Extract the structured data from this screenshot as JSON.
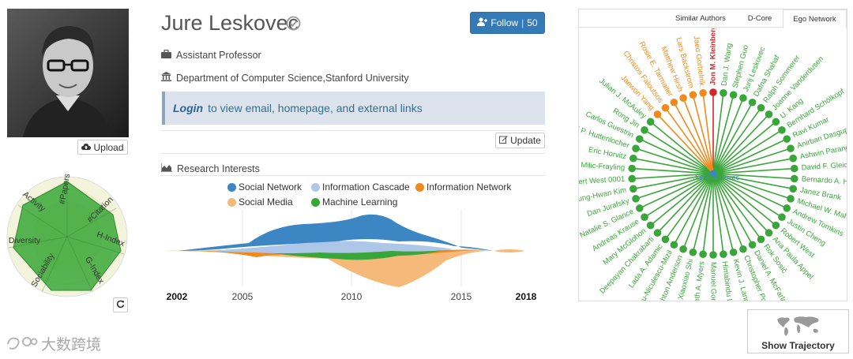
{
  "profile": {
    "name": "Jure Leskovec",
    "follow_label": "Follow",
    "follow_count": "50",
    "position": "Assistant Professor",
    "affiliation": "Department of Computer Science,Stanford University",
    "upload_label": "Upload",
    "update_label": "Update"
  },
  "login_banner": {
    "link_text": "Login",
    "text": "to view email, homepage, and external links"
  },
  "radar": {
    "axes": [
      "#Papers",
      "#Citation",
      "H-Index",
      "G-Index",
      "Sociability",
      "Diversity",
      "Activity"
    ],
    "fill_color": "#3aa83a"
  },
  "research_interests": {
    "title": "Research Interests",
    "chart_data": {
      "type": "area",
      "x_ticks": [
        "2002",
        "2005",
        "2010",
        "2015",
        "2018"
      ],
      "series": [
        {
          "name": "Social Network",
          "color": "#3c87c3"
        },
        {
          "name": "Information Cascade",
          "color": "#aec7e8"
        },
        {
          "name": "Information Network",
          "color": "#f08a1c"
        },
        {
          "name": "Social Media",
          "color": "#f5b97a"
        },
        {
          "name": "Machine Learning",
          "color": "#3aa63a"
        }
      ]
    }
  },
  "ego_network": {
    "tabs": [
      "Similar Authors",
      "D-Core",
      "Ego Network"
    ],
    "active_tab": "Ego Network",
    "center_label": "Jure Leskovec",
    "highlight": "Jon M. Kleinberg",
    "nodes": [
      {
        "name": "Jon M. Kleinberg",
        "color": "#d62728"
      },
      {
        "name": "Dan J. Wang",
        "color": "#3aa63a"
      },
      {
        "name": "Stephen Guo",
        "color": "#3aa63a"
      },
      {
        "name": "Jurij Leskovec",
        "color": "#3aa63a"
      },
      {
        "name": "Dafna Shahaf",
        "color": "#3aa63a"
      },
      {
        "name": "Ralph Sommerer",
        "color": "#3aa63a"
      },
      {
        "name": "Joanne Vanderdusen",
        "color": "#3aa63a"
      },
      {
        "name": "U. Kang",
        "color": "#3aa63a"
      },
      {
        "name": "Bernhard Schölkopf",
        "color": "#3aa63a"
      },
      {
        "name": "Ravi Kumar",
        "color": "#3aa63a"
      },
      {
        "name": "Anirban Dasgupta",
        "color": "#3aa63a"
      },
      {
        "name": "Ashwin Paranjape",
        "color": "#3aa63a"
      },
      {
        "name": "David F. Gleich",
        "color": "#3aa63a"
      },
      {
        "name": "Bernardo A. Huberman",
        "color": "#3aa63a"
      },
      {
        "name": "Janez Brank",
        "color": "#3aa63a"
      },
      {
        "name": "Michael W. Mahoney",
        "color": "#3aa63a"
      },
      {
        "name": "Andrew Tomkins",
        "color": "#3aa63a"
      },
      {
        "name": "Justin Cheng",
        "color": "#3aa63a"
      },
      {
        "name": "Robert West",
        "color": "#3aa63a"
      },
      {
        "name": "Ana Paula Appel",
        "color": "#3aa63a"
      },
      {
        "name": "Rok Sosič",
        "color": "#3aa63a"
      },
      {
        "name": "Daniel A. McFarland",
        "color": "#3aa63a"
      },
      {
        "name": "Christopher Potts",
        "color": "#3aa63a"
      },
      {
        "name": "Kevin J. Lang",
        "color": "#3aa63a"
      },
      {
        "name": "Himabindu Lakkaraju",
        "color": "#3aa63a"
      },
      {
        "name": "Manuel Gomez Rodriguez",
        "color": "#3aa63a"
      },
      {
        "name": "Seth A. Myers",
        "color": "#3aa63a"
      },
      {
        "name": "Xiaoxiao Shi",
        "color": "#3aa63a"
      },
      {
        "name": "Ashton Anderson",
        "color": "#3aa63a"
      },
      {
        "name": "Cristian Danescu-Niculescu-Mizil",
        "color": "#3aa63a"
      },
      {
        "name": "Lada A. Adamic",
        "color": "#3aa63a"
      },
      {
        "name": "Deepayan Chakrabarti",
        "color": "#3aa63a"
      },
      {
        "name": "Mary McGlohon",
        "color": "#3aa63a"
      },
      {
        "name": "Andreas Krause",
        "color": "#3aa63a"
      },
      {
        "name": "Natalie S. Glance",
        "color": "#3aa63a"
      },
      {
        "name": "Dan Jurafsky",
        "color": "#3aa63a"
      },
      {
        "name": "Sung-Hwan Kim",
        "color": "#3aa63a"
      },
      {
        "name": "Robert West 0001",
        "color": "#3aa63a"
      },
      {
        "name": "Natasa Milic-Frayling",
        "color": "#3aa63a"
      },
      {
        "name": "Eric Horvitz",
        "color": "#3aa63a"
      },
      {
        "name": "Daniel P. Huttenlocher",
        "color": "#3aa63a"
      },
      {
        "name": "Carlos Guestrin",
        "color": "#3aa63a"
      },
      {
        "name": "Rong Jin",
        "color": "#3aa63a"
      },
      {
        "name": "Julian J. McAuley",
        "color": "#3aa63a"
      },
      {
        "name": "Jaewon Yang",
        "color": "#f08a1c"
      },
      {
        "name": "Christos Faloutsos",
        "color": "#f08a1c"
      },
      {
        "name": "Rosie E. Tarmaiter",
        "color": "#f08a1c"
      },
      {
        "name": "Matthew Hirsh",
        "color": "#f08a1c"
      },
      {
        "name": "Lars Backstrom",
        "color": "#f08a1c"
      },
      {
        "name": "Jaeo Gorbelnik",
        "color": "#f08a1c"
      }
    ]
  },
  "trajectory": {
    "label": "Show Trajectory"
  },
  "watermark": {
    "text": "大数跨境"
  }
}
